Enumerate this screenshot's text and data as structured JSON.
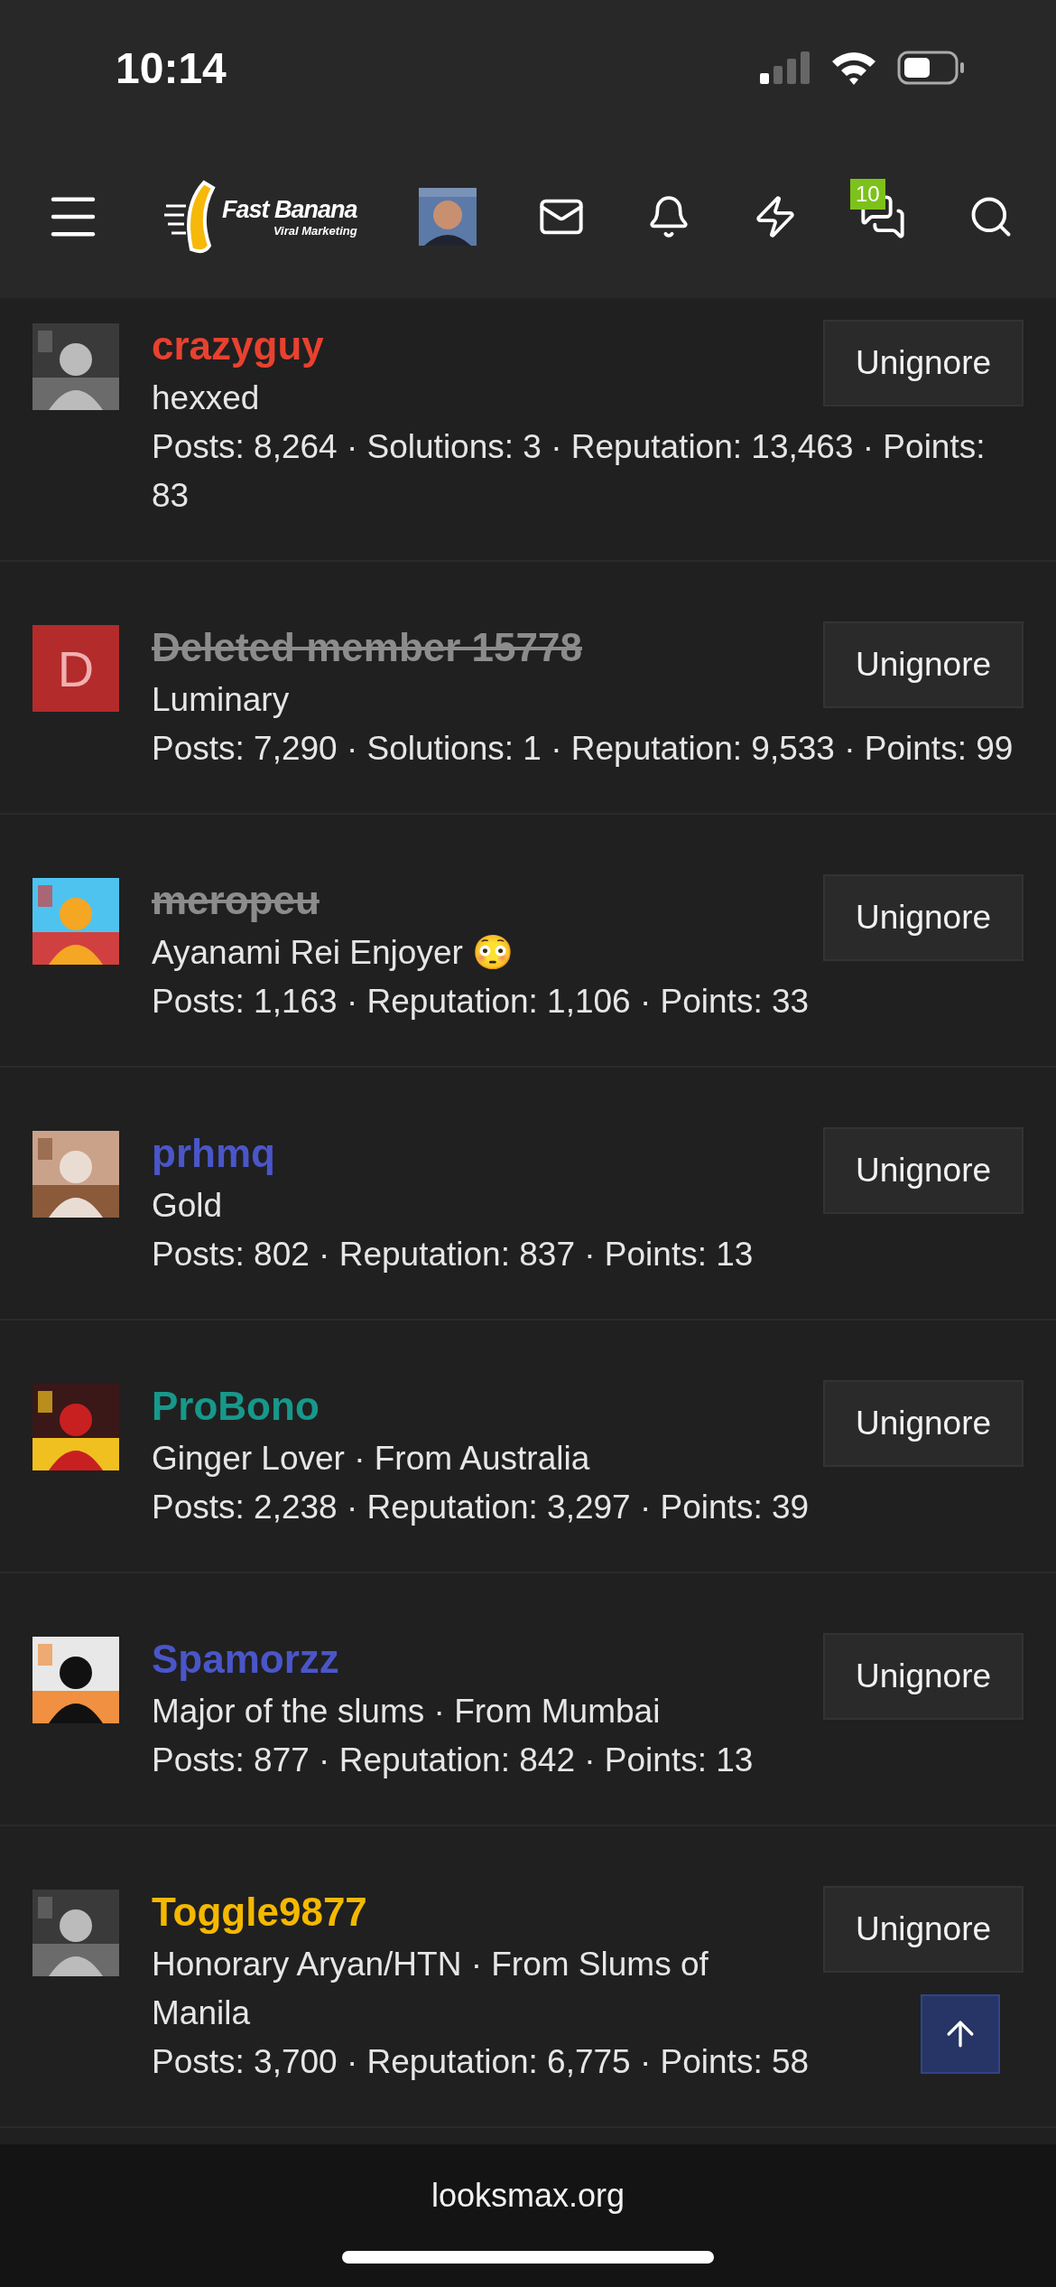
{
  "status_bar": {
    "time": "10:14"
  },
  "header": {
    "logo": {
      "title": "Fast Banana",
      "subtitle": "Viral Marketing"
    },
    "conversations_badge": "10"
  },
  "members": [
    {
      "name": "crazyguy",
      "color": "#e8412f",
      "struck": false,
      "title": "hexxed",
      "stats": "Posts: 8,264 · Solutions: 3 · Reputation: 13,463 · Points: 83",
      "button": "Unignore"
    },
    {
      "name": "Deleted member 15778",
      "color": "#8c8c8c",
      "struck": true,
      "avatar": {
        "kind": "letter",
        "letter": "D",
        "color": "#b32b2b"
      },
      "title": "Luminary",
      "stats": "Posts: 7,290 · Solutions: 1 · Reputation: 9,533 · Points: 99",
      "button": "Unignore"
    },
    {
      "name": "meropeu",
      "color": "#8c8c8c",
      "struck": true,
      "title": "Ayanami Rei Enjoyer 😳",
      "stats": "Posts: 1,163 · Reputation: 1,106 · Points: 33",
      "button": "Unignore"
    },
    {
      "name": "prhmq",
      "color": "#4a56c8",
      "struck": false,
      "title": "Gold",
      "stats": "Posts: 802 · Reputation: 837 · Points: 13",
      "button": "Unignore"
    },
    {
      "name": "ProBono",
      "color": "#17988a",
      "struck": false,
      "title": "Ginger Lover · From Australia",
      "stats": "Posts: 2,238 · Reputation: 3,297 · Points: 39",
      "button": "Unignore"
    },
    {
      "name": "Spamorzz",
      "color": "#4a56c8",
      "struck": false,
      "title": "Major of the slums · From Mumbai",
      "stats": "Posts: 877 · Reputation: 842 · Points: 13",
      "button": "Unignore"
    },
    {
      "name": "Toggle9877",
      "color": "#f5b800",
      "struck": false,
      "title": "Honorary Aryan/HTN · From Slums of Manila",
      "stats": "Posts: 3,700 · Reputation: 6,775 · Points: 58",
      "button": "Unignore"
    }
  ],
  "footer": {
    "domain": "looksmax.org"
  }
}
